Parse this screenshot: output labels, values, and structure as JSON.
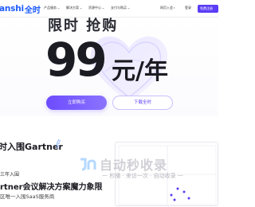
{
  "nav": {
    "brand": "anshi",
    "brand_cn": "全时",
    "links": [
      "产品服务",
      "解决方案",
      "资源中心",
      "支付与购买"
    ],
    "login": "网页入会",
    "login_arrow": "▾",
    "signin": "登录",
    "cta": "免费注册"
  },
  "hero": {
    "top_text": "限时 抢购",
    "price": "99",
    "unit": "元/年",
    "buy_button": "立即购买",
    "download_button": "下载全时"
  },
  "gartner": {
    "title": "时入围Gartner",
    "years": "三年入围",
    "headline": "rtner会议解决方案魔力象限",
    "subline": "区唯一入围SaaS服务商"
  },
  "watermark": {
    "text": "自动秒收录",
    "sub": "一 秒播 · 来访一次 · 自动收录 一"
  },
  "colors": {
    "brand": "#1e5cff",
    "accent": "#6d4cff"
  }
}
